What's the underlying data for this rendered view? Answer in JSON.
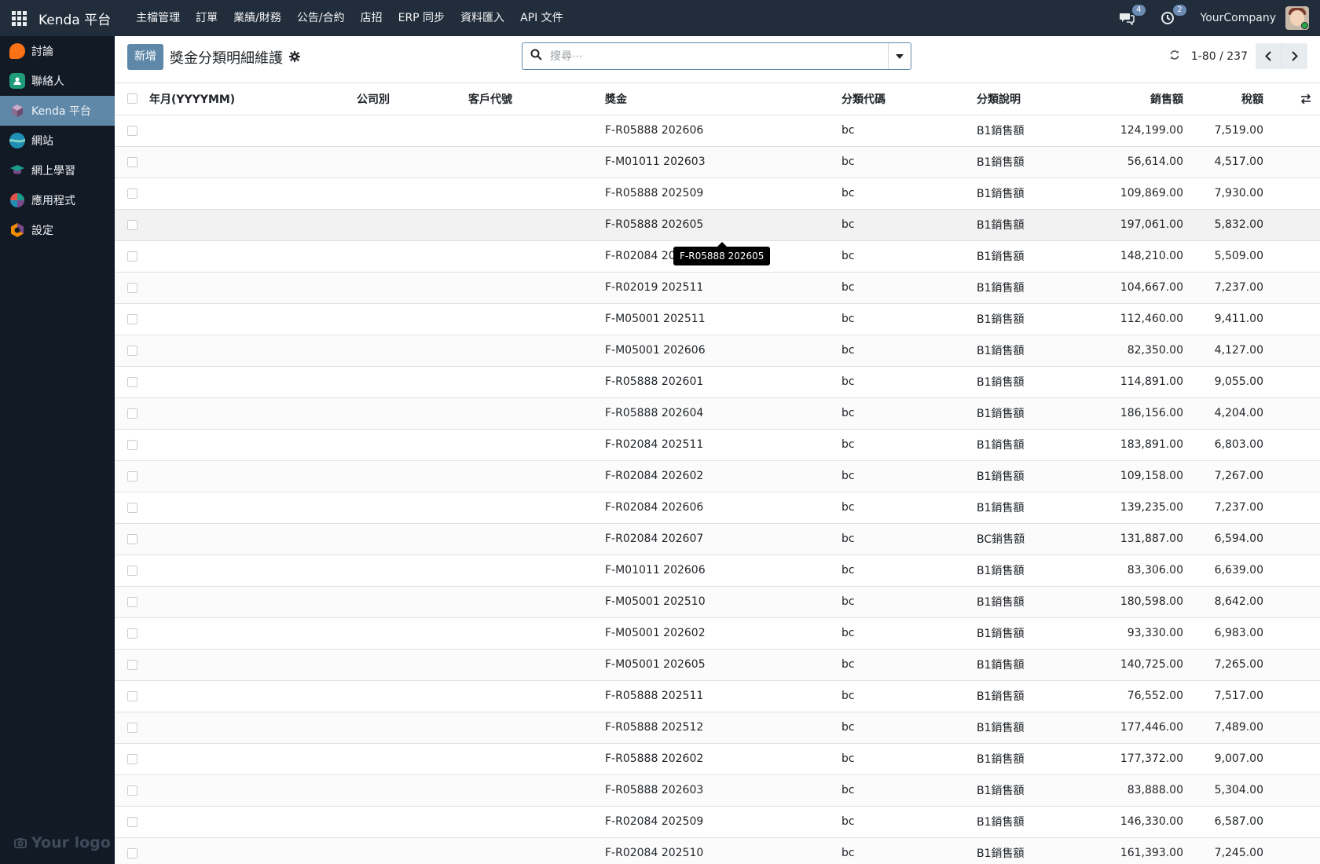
{
  "navbar": {
    "brand": "Kenda 平台",
    "menu": [
      "主檔管理",
      "訂單",
      "業績/財務",
      "公告/合約",
      "店招",
      "ERP 同步",
      "資料匯入",
      "API 文件"
    ],
    "messages_count": "4",
    "activities_count": "2",
    "company": "YourCompany"
  },
  "sidebar": {
    "items": [
      {
        "label": "討論",
        "icon": "discuss-icon",
        "color": "#f97316"
      },
      {
        "label": "聯絡人",
        "icon": "contacts-icon",
        "color": "#1f9d7a"
      },
      {
        "label": "Kenda 平台",
        "icon": "kenda-cube-icon",
        "color": "#8a6d8e"
      },
      {
        "label": "網站",
        "icon": "website-icon",
        "color": "#1f8fb3"
      },
      {
        "label": "網上學習",
        "icon": "elearning-icon",
        "color": "#1c9d8b"
      },
      {
        "label": "應用程式",
        "icon": "apps-pie-icon",
        "color": "#e5534b"
      },
      {
        "label": "設定",
        "icon": "settings-icon",
        "color": "#f08c00"
      }
    ],
    "active_index": 2,
    "logo_text": "Your logo"
  },
  "control": {
    "new_label": "新增",
    "title": "獎金分類明細維護",
    "search_placeholder": "搜尋⋯",
    "pager_value": "1-80 / 237"
  },
  "table": {
    "columns": [
      "年月(YYYYMM)",
      "公司別",
      "客戶代號",
      "獎金",
      "分類代碼",
      "分類說明",
      "銷售額",
      "稅額"
    ],
    "rows": [
      [
        "",
        "",
        "",
        "F-R05888 202606",
        "bc",
        "B1銷售額",
        "124,199.00",
        "7,519.00"
      ],
      [
        "",
        "",
        "",
        "F-M01011 202603",
        "bc",
        "B1銷售額",
        "56,614.00",
        "4,517.00"
      ],
      [
        "",
        "",
        "",
        "F-R05888 202509",
        "bc",
        "B1銷售額",
        "109,869.00",
        "7,930.00"
      ],
      [
        "",
        "",
        "",
        "F-R05888 202605",
        "bc",
        "B1銷售額",
        "197,061.00",
        "5,832.00"
      ],
      [
        "",
        "",
        "",
        "F-R02084 202",
        "bc",
        "B1銷售額",
        "148,210.00",
        "5,509.00"
      ],
      [
        "",
        "",
        "",
        "F-R02019 202511",
        "bc",
        "B1銷售額",
        "104,667.00",
        "7,237.00"
      ],
      [
        "",
        "",
        "",
        "F-M05001 202511",
        "bc",
        "B1銷售額",
        "112,460.00",
        "9,411.00"
      ],
      [
        "",
        "",
        "",
        "F-M05001 202606",
        "bc",
        "B1銷售額",
        "82,350.00",
        "4,127.00"
      ],
      [
        "",
        "",
        "",
        "F-R05888 202601",
        "bc",
        "B1銷售額",
        "114,891.00",
        "9,055.00"
      ],
      [
        "",
        "",
        "",
        "F-R05888 202604",
        "bc",
        "B1銷售額",
        "186,156.00",
        "4,204.00"
      ],
      [
        "",
        "",
        "",
        "F-R02084 202511",
        "bc",
        "B1銷售額",
        "183,891.00",
        "6,803.00"
      ],
      [
        "",
        "",
        "",
        "F-R02084 202602",
        "bc",
        "B1銷售額",
        "109,158.00",
        "7,267.00"
      ],
      [
        "",
        "",
        "",
        "F-R02084 202606",
        "bc",
        "B1銷售額",
        "139,235.00",
        "7,237.00"
      ],
      [
        "",
        "",
        "",
        "F-R02084 202607",
        "bc",
        "BC銷售額",
        "131,887.00",
        "6,594.00"
      ],
      [
        "",
        "",
        "",
        "F-M01011 202606",
        "bc",
        "B1銷售額",
        "83,306.00",
        "6,639.00"
      ],
      [
        "",
        "",
        "",
        "F-M05001 202510",
        "bc",
        "B1銷售額",
        "180,598.00",
        "8,642.00"
      ],
      [
        "",
        "",
        "",
        "F-M05001 202602",
        "bc",
        "B1銷售額",
        "93,330.00",
        "6,983.00"
      ],
      [
        "",
        "",
        "",
        "F-M05001 202605",
        "bc",
        "B1銷售額",
        "140,725.00",
        "7,265.00"
      ],
      [
        "",
        "",
        "",
        "F-R05888 202511",
        "bc",
        "B1銷售額",
        "76,552.00",
        "7,517.00"
      ],
      [
        "",
        "",
        "",
        "F-R05888 202512",
        "bc",
        "B1銷售額",
        "177,446.00",
        "7,489.00"
      ],
      [
        "",
        "",
        "",
        "F-R05888 202602",
        "bc",
        "B1銷售額",
        "177,372.00",
        "9,007.00"
      ],
      [
        "",
        "",
        "",
        "F-R05888 202603",
        "bc",
        "B1銷售額",
        "83,888.00",
        "5,304.00"
      ],
      [
        "",
        "",
        "",
        "F-R02084 202509",
        "bc",
        "B1銷售額",
        "146,330.00",
        "6,587.00"
      ],
      [
        "",
        "",
        "",
        "F-R02084 202510",
        "bc",
        "B1銷售額",
        "161,393.00",
        "7,245.00"
      ]
    ],
    "hovered_row": 3
  },
  "tooltip": {
    "text": "F-R05888 202605"
  },
  "colors": {
    "navbar": "#212d3b",
    "sidebar": "#121a26",
    "accent": "#5f88a8"
  }
}
